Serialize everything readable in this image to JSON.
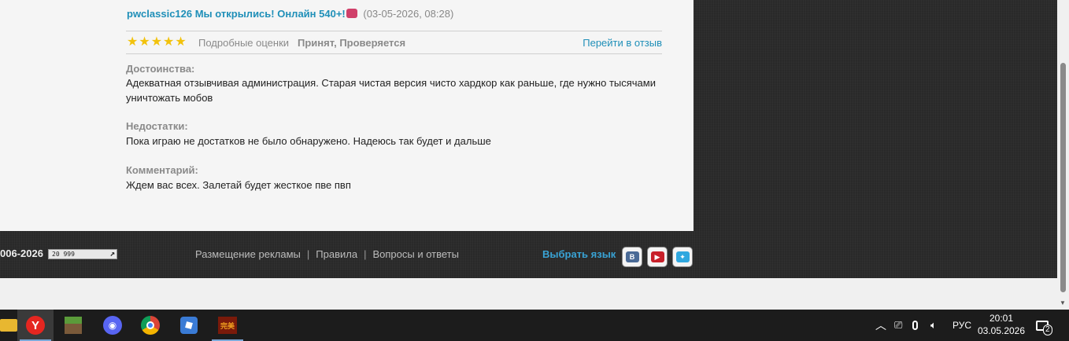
{
  "review": {
    "author": "pwclassic126 Мы открылись! Онлайн 540+!",
    "date": "(03-05-2026, 08:28)",
    "rating_stars": 5,
    "detailed_ratings": "Подробные оценки",
    "status": "Принят, Проверяется",
    "goto_link": "Перейти в отзыв",
    "pros_label": "Достоинства:",
    "pros_text": "Адекватная отзывчивая администрация. Старая чистая версия чисто хардкор как раньше, где нужно тысячами уничтожать мобов",
    "cons_label": "Недостатки:",
    "cons_text": "Пока играю не достатков не было обнаружено. Надеюсь так будет и дальше",
    "comment_label": "Комментарий:",
    "comment_text": "Ждем вас всех. Залетай будет жесткое пве пвп"
  },
  "footer": {
    "copyright": "006-2026",
    "counter": "20 999",
    "links": [
      "Размещение рекламы",
      "Правила",
      "Вопросы и ответы"
    ],
    "choose_language": "Выбрать язык",
    "social": [
      {
        "icon": "vk-icon",
        "glyph": "В",
        "color": "#4a6a96"
      },
      {
        "icon": "youtube-icon",
        "glyph": "▶",
        "color": "#c8202a"
      },
      {
        "icon": "twitter-icon",
        "glyph": "✦",
        "color": "#2fa7df"
      }
    ]
  },
  "taskbar": {
    "apps": [
      {
        "icon": "file-explorer-icon",
        "active": false
      },
      {
        "icon": "yandex-browser-icon",
        "active": true
      },
      {
        "icon": "minecraft-icon",
        "active": false
      },
      {
        "icon": "discord-icon",
        "active": false
      },
      {
        "icon": "chrome-icon",
        "active": false
      },
      {
        "icon": "roblox-icon",
        "active": false
      },
      {
        "icon": "perfect-world-icon",
        "active": false
      }
    ],
    "language": "РУС",
    "time": "20:01",
    "date": "03.05.2026",
    "notifications": "2"
  }
}
